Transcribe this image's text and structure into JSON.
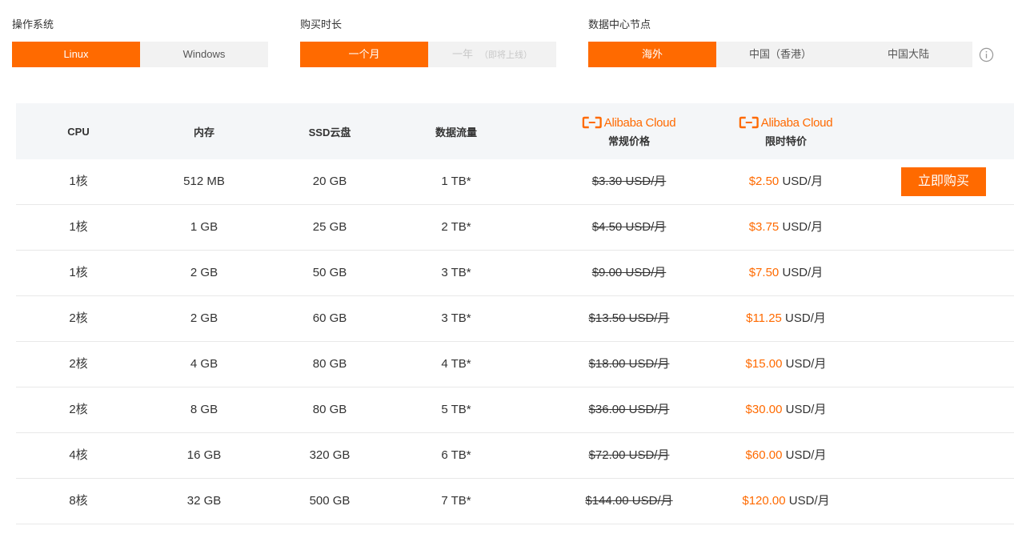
{
  "filters": {
    "os": {
      "label": "操作系统",
      "options": [
        {
          "label": "Linux",
          "active": true
        },
        {
          "label": "Windows",
          "active": false
        }
      ]
    },
    "duration": {
      "label": "购买时长",
      "options": [
        {
          "label": "一个月",
          "active": true
        },
        {
          "label": "一年",
          "sub": "（即将上线）",
          "active": false,
          "disabled": true
        }
      ]
    },
    "region": {
      "label": "数据中心节点",
      "options": [
        {
          "label": "海外",
          "active": true
        },
        {
          "label": "中国（香港）",
          "active": false
        },
        {
          "label": "中国大陆",
          "active": false
        }
      ]
    }
  },
  "info_icon": "info-circle-icon",
  "table": {
    "headers": {
      "cpu": "CPU",
      "memory": "内存",
      "disk": "SSD云盘",
      "traffic": "数据流量",
      "logo_text": "Alibaba Cloud",
      "regular_price": "常规价格",
      "special_price": "限时特价"
    },
    "currency_unit": "USD/月",
    "buy_label": "立即购买",
    "rows": [
      {
        "cpu": "1核",
        "memory": "512 MB",
        "disk": "20 GB",
        "traffic": "1 TB*",
        "regular": "$3.30",
        "special": "$2.50"
      },
      {
        "cpu": "1核",
        "memory": "1 GB",
        "disk": "25 GB",
        "traffic": "2 TB*",
        "regular": "$4.50",
        "special": "$3.75"
      },
      {
        "cpu": "1核",
        "memory": "2 GB",
        "disk": "50 GB",
        "traffic": "3 TB*",
        "regular": "$9.00",
        "special": "$7.50"
      },
      {
        "cpu": "2核",
        "memory": "2 GB",
        "disk": "60 GB",
        "traffic": "3 TB*",
        "regular": "$13.50",
        "special": "$11.25"
      },
      {
        "cpu": "2核",
        "memory": "4 GB",
        "disk": "80 GB",
        "traffic": "4 TB*",
        "regular": "$18.00",
        "special": "$15.00"
      },
      {
        "cpu": "2核",
        "memory": "8 GB",
        "disk": "80 GB",
        "traffic": "5 TB*",
        "regular": "$36.00",
        "special": "$30.00"
      },
      {
        "cpu": "4核",
        "memory": "16 GB",
        "disk": "320 GB",
        "traffic": "6 TB*",
        "regular": "$72.00",
        "special": "$60.00"
      },
      {
        "cpu": "8核",
        "memory": "32 GB",
        "disk": "500 GB",
        "traffic": "7 TB*",
        "regular": "$144.00",
        "special": "$120.00"
      }
    ]
  },
  "colors": {
    "accent": "#ff6a00",
    "header_bg": "#f4f6f8",
    "seg_bg": "#f2f2f2"
  }
}
